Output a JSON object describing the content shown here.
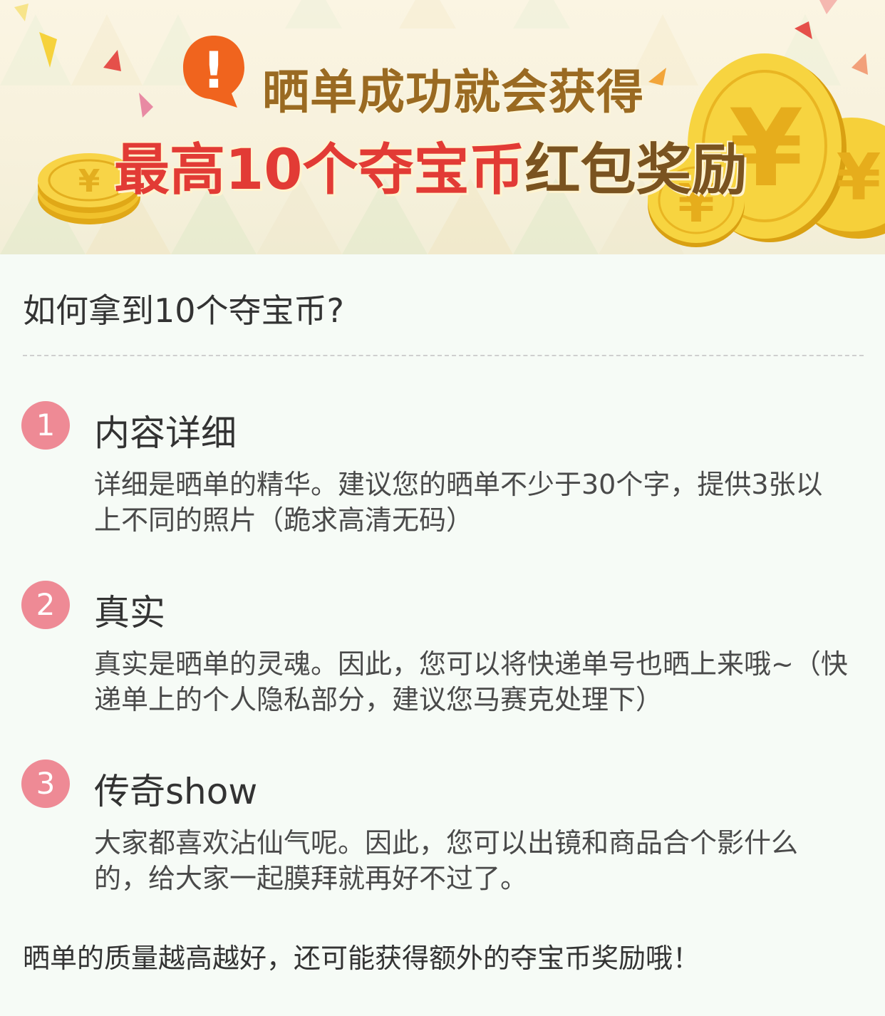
{
  "banner": {
    "line1": "晒单成功就会获得",
    "line2_highlight": "最高10个夺宝币",
    "line2_rest": "红包奖励",
    "alert_glyph": "!",
    "coin_glyph": "¥"
  },
  "question": "如何拿到10个夺宝币?",
  "steps": [
    {
      "number": "1",
      "title": "内容详细",
      "description": "详细是晒单的精华。建议您的晒单不少于30个字，提供3张以上不同的照片（跪求高清无码）"
    },
    {
      "number": "2",
      "title": "真实",
      "description": "真实是晒单的灵魂。因此，您可以将快递单号也晒上来哦~（快递单上的个人隐私部分，建议您马赛克处理下）"
    },
    {
      "number": "3",
      "title": "传奇show",
      "description": "大家都喜欢沾仙气呢。因此，您可以出镜和商品合个影什么的，给大家一起膜拜就再好不过了。"
    }
  ],
  "footer_note": "晒单的质量越高越好，还可能获得额外的夺宝币奖励哦！",
  "colors": {
    "accent_red": "#e23b35",
    "badge_pink": "#ee8a95",
    "coin_gold": "#f5c518",
    "background": "#f6fbf6"
  }
}
